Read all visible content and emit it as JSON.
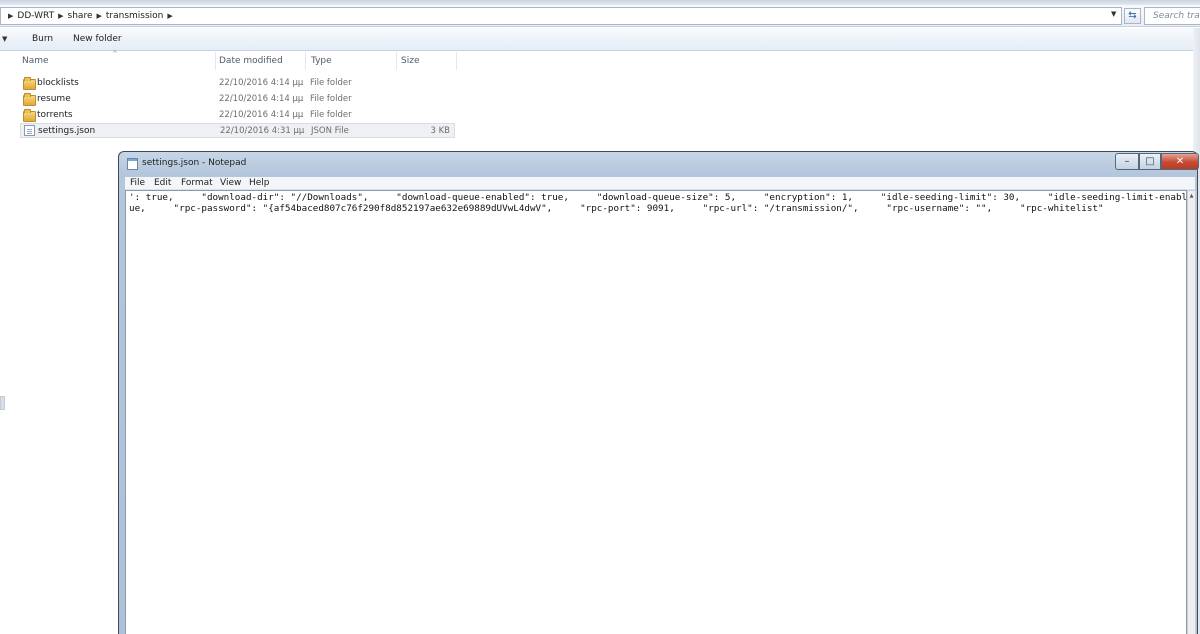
{
  "explorer": {
    "breadcrumbs": [
      "DD-WRT",
      "share",
      "transmission"
    ],
    "search_placeholder": "Search transmission",
    "toolbar": {
      "burn_label": "Burn",
      "new_folder_label": "New folder"
    },
    "columns": {
      "name": "Name",
      "date": "Date modified",
      "type": "Type",
      "size": "Size"
    },
    "files": [
      {
        "name": "blocklists",
        "date": "22/10/2016 4:14 μμ",
        "type": "File folder",
        "size": "",
        "icon": "folder-icon"
      },
      {
        "name": "resume",
        "date": "22/10/2016 4:14 μμ",
        "type": "File folder",
        "size": "",
        "icon": "folder-icon"
      },
      {
        "name": "torrents",
        "date": "22/10/2016 4:14 μμ",
        "type": "File folder",
        "size": "",
        "icon": "folder-icon"
      },
      {
        "name": "settings.json",
        "date": "22/10/2016 4:31 μμ",
        "type": "JSON File",
        "size": "3 KB",
        "icon": "json-file-icon"
      }
    ]
  },
  "notepad": {
    "title": "settings.json - Notepad",
    "menu": [
      "File",
      "Edit",
      "Format",
      "View",
      "Help"
    ],
    "lines": [
      "': true,     \"download-dir\": \"//Downloads\",     \"download-queue-enabled\": true,     \"download-queue-size\": 5,     \"encryption\": 1,     \"idle-seeding-limit\": 30,     \"idle-seeding-limit-enabled\"",
      "ue,     \"rpc-password\": \"{af54baced807c76f290f8d852197ae632e69889dUVwL4dwV\",     \"rpc-port\": 9091,     \"rpc-url\": \"/transmission/\",     \"rpc-username\": \"\",     \"rpc-whitelist\""
    ]
  }
}
